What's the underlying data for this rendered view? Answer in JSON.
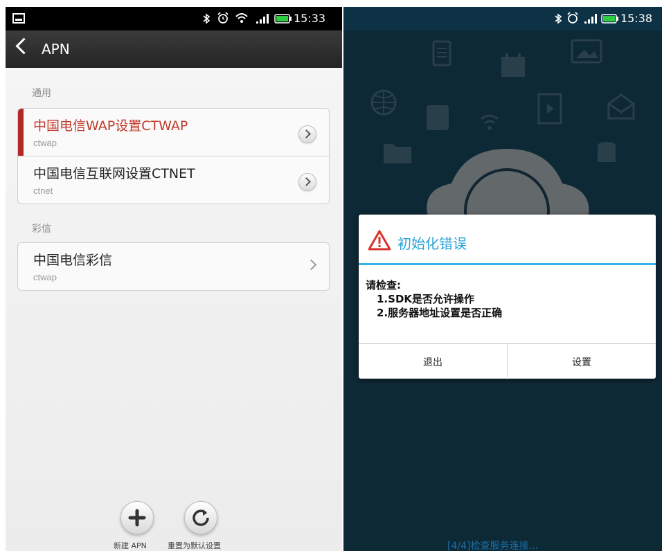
{
  "left": {
    "statusbar": {
      "time": "15:33",
      "icons": [
        "image-icon",
        "bluetooth-icon",
        "alarm-icon",
        "wifi-icon",
        "signal-icon",
        "battery-icon"
      ]
    },
    "titlebar": {
      "title": "APN"
    },
    "sections": [
      {
        "label": "通用",
        "items": [
          {
            "name": "中国电信WAP设置CTWAP",
            "sub": "ctwap",
            "active": true
          },
          {
            "name": "中国电信互联网设置CTNET",
            "sub": "ctnet",
            "active": false
          }
        ]
      },
      {
        "label": "彩信",
        "items": [
          {
            "name": "中国电信彩信",
            "sub": "ctwap",
            "active": false
          }
        ]
      }
    ],
    "bottom": {
      "add_label": "新建 APN",
      "reset_label": "重置为默认设置"
    }
  },
  "right": {
    "statusbar": {
      "time": "15:38"
    },
    "dialog": {
      "title": "初始化错误",
      "msg_line1": "请检查:",
      "msg_line2": "1.SDK是否允许操作",
      "msg_line3": "2.服务器地址设置是否正确",
      "btn_exit": "退出",
      "btn_settings": "设置"
    },
    "status_text": "[4/4]检查服务连接..."
  },
  "colors": {
    "active_red": "#b3262a",
    "dialog_accent": "#33b5e5",
    "bg_blue": "#1f5b78"
  }
}
